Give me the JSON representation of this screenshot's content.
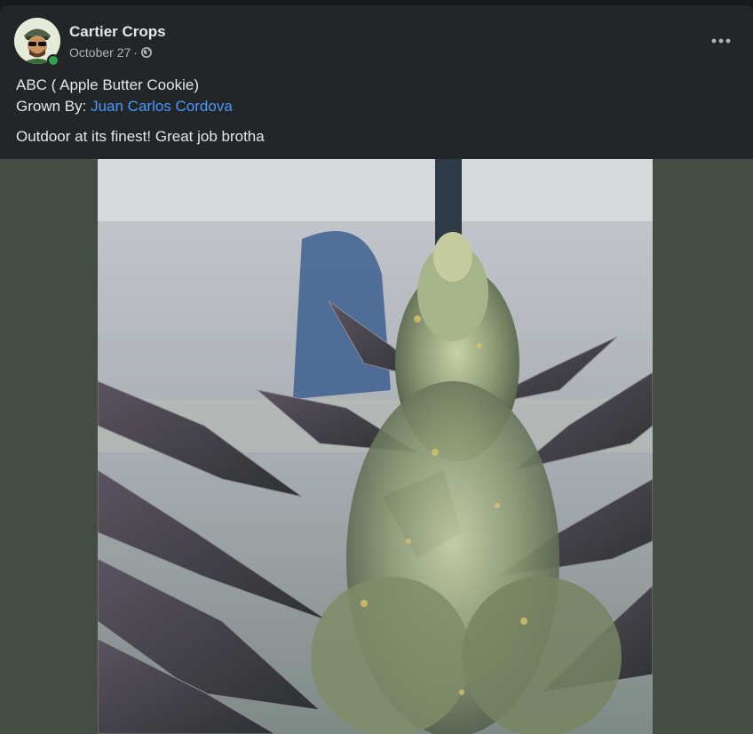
{
  "post": {
    "author": "Cartier Crops",
    "date": "October 27",
    "separator": "·",
    "audience_icon": "globe-icon",
    "more_icon": "more-options-icon",
    "title": "ABC ( Apple Butter Cookie)",
    "grown_by_label": "Grown By:",
    "grower_link": "Juan Carlos Cordova",
    "caption": "Outdoor at its finest! Great job brotha",
    "photo_icon": "cannabis-plant-photo"
  },
  "colors": {
    "card": "#242526",
    "page": "#18191a",
    "text": "#e4e6eb",
    "secondary_text": "#b0b3b8",
    "link": "#4599ff",
    "online": "#31a24c",
    "media_bg": "#444c43"
  }
}
